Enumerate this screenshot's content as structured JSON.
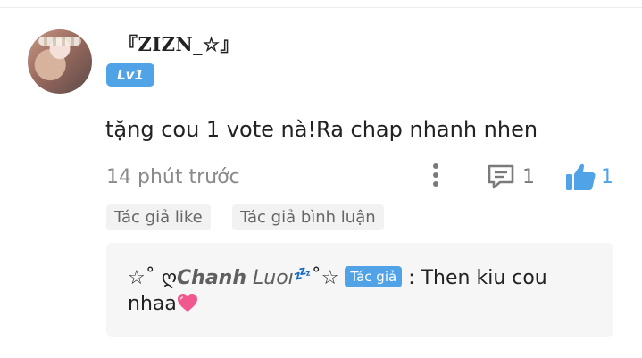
{
  "user": {
    "name": "『ZIZN_☆』",
    "level": "Lv1"
  },
  "comment": {
    "text": "tặng cou 1 vote nà!Ra chap nhanh nhen",
    "time": "14 phút trước",
    "reply_count": "1",
    "like_count": "1"
  },
  "tags": {
    "like": "Tác giả like",
    "comment": "Tác giả bình luận"
  },
  "reply": {
    "prefix": "☆˚ ღ",
    "name_bold": "Chanh",
    "name_light": " Luoı",
    "zz": "💤",
    "suffix": "˚☆",
    "badge": "Tác giả",
    "separator": " : ",
    "text_line1": "Then kiu cou",
    "text_line2": "nhaa"
  },
  "icons": {
    "more": "more-vertical-icon",
    "reply": "comment-icon",
    "like": "thumbs-up-icon",
    "heart": "heart-icon"
  },
  "colors": {
    "accent": "#4fa3e6",
    "muted": "#8a8a8a",
    "tag_bg": "#f2f2f2",
    "reply_bg": "#f6f6f6"
  }
}
